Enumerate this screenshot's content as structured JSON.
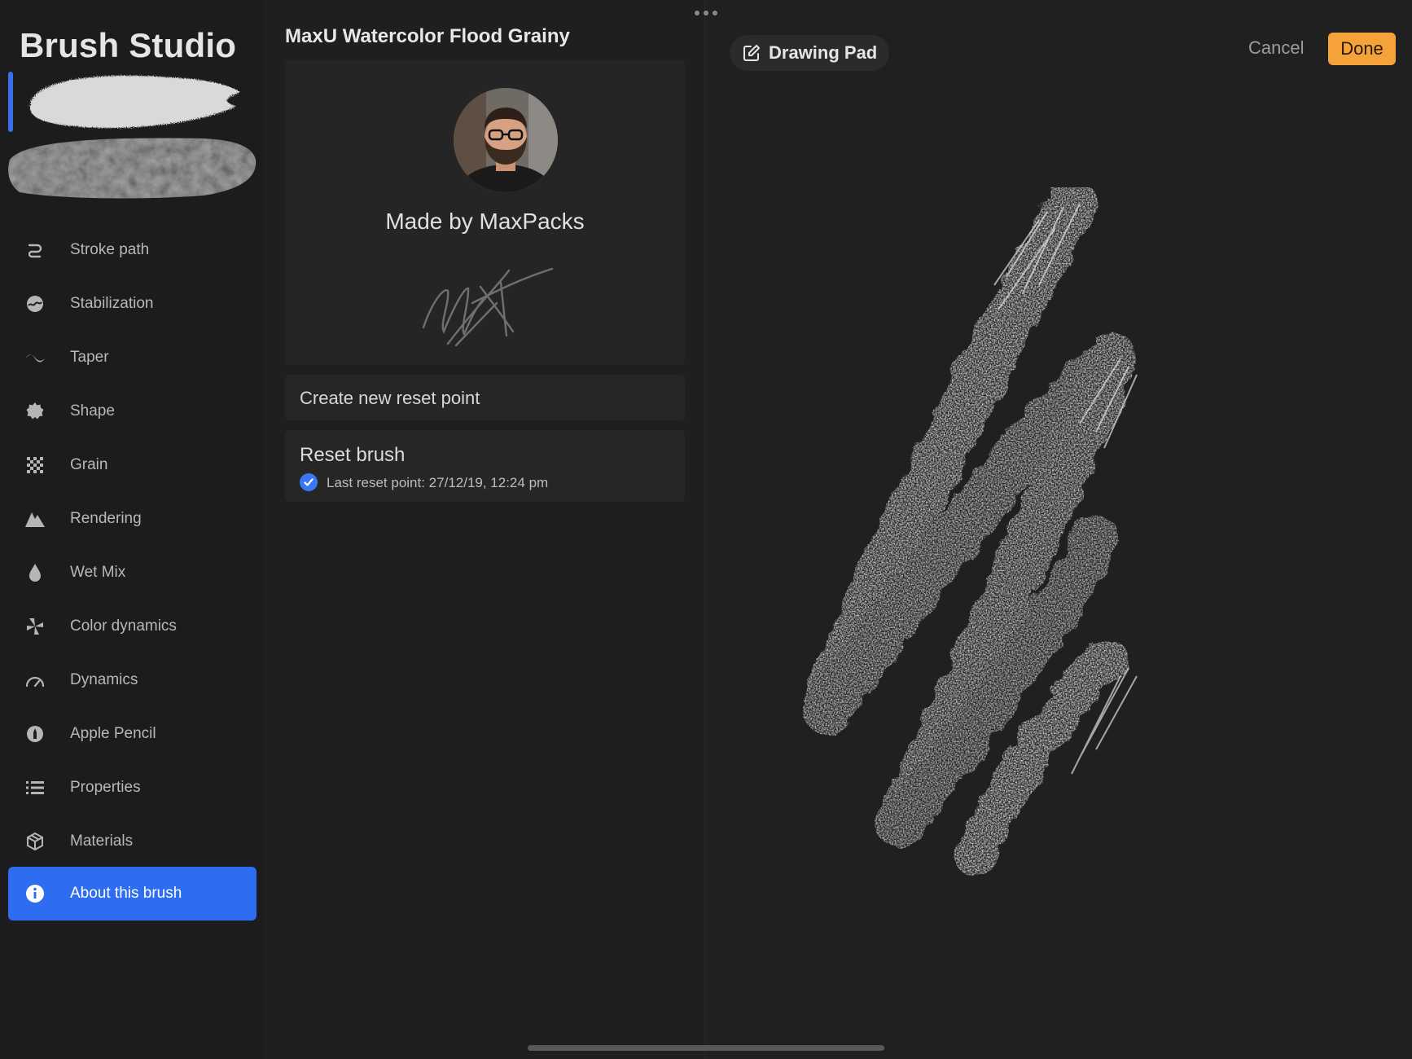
{
  "app": {
    "title": "Brush Studio"
  },
  "sidebar": {
    "items": [
      {
        "label": "Stroke path",
        "icon": "stroke-path-icon"
      },
      {
        "label": "Stabilization",
        "icon": "stabilization-icon"
      },
      {
        "label": "Taper",
        "icon": "taper-icon"
      },
      {
        "label": "Shape",
        "icon": "shape-icon"
      },
      {
        "label": "Grain",
        "icon": "grain-icon"
      },
      {
        "label": "Rendering",
        "icon": "rendering-icon"
      },
      {
        "label": "Wet Mix",
        "icon": "wet-mix-icon"
      },
      {
        "label": "Color dynamics",
        "icon": "color-dynamics-icon"
      },
      {
        "label": "Dynamics",
        "icon": "dynamics-icon"
      },
      {
        "label": "Apple Pencil",
        "icon": "apple-pencil-icon"
      },
      {
        "label": "Properties",
        "icon": "properties-icon"
      },
      {
        "label": "Materials",
        "icon": "materials-icon"
      },
      {
        "label": "About this brush",
        "icon": "info-icon",
        "active": true
      }
    ]
  },
  "about": {
    "brush_name": "MaxU Watercolor Flood Grainy",
    "author": "Made by MaxPacks",
    "create_reset_label": "Create new reset point",
    "reset_label": "Reset brush",
    "last_reset": "Last reset point: 27/12/19, 12:24 pm"
  },
  "pad": {
    "label": "Drawing Pad",
    "cancel_label": "Cancel",
    "done_label": "Done"
  },
  "colors": {
    "accent": "#2f6df0",
    "done": "#f5a23a",
    "background": "#1c1c1e"
  }
}
